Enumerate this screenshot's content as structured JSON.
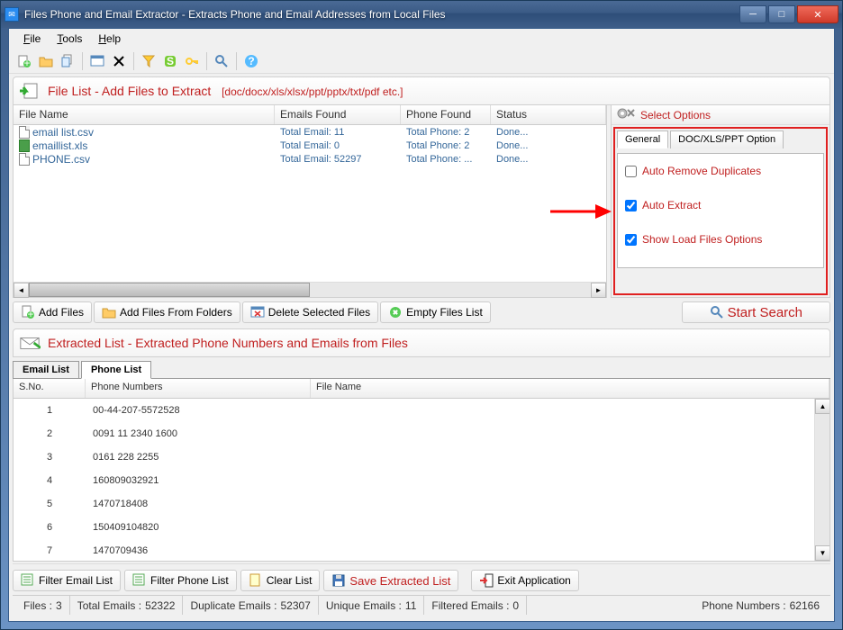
{
  "window": {
    "title": "Files Phone and Email Extractor -  Extracts Phone and Email Addresses from Local Files"
  },
  "menu": {
    "file": "File",
    "tools": "Tools",
    "help": "Help"
  },
  "panelTop": {
    "title": "File List - Add Files to Extract",
    "sub": "[doc/docx/xls/xlsx/ppt/pptx/txt/pdf etc.]"
  },
  "fileGrid": {
    "cols": {
      "name": "File Name",
      "emails": "Emails Found",
      "phone": "Phone Found",
      "status": "Status"
    },
    "rows": [
      {
        "name": "email list.csv",
        "emails": "Total Email: 11",
        "phone": "Total Phone: 2",
        "status": "Done..."
      },
      {
        "name": "emaillist.xls",
        "emails": "Total Email: 0",
        "phone": "Total Phone: 2",
        "status": "Done..."
      },
      {
        "name": "PHONE.csv",
        "emails": "Total Email: 52297",
        "phone": "Total Phone: ...",
        "status": "Done..."
      }
    ]
  },
  "options": {
    "title": "Select Options",
    "tabGeneral": "General",
    "tabDoc": "DOC/XLS/PPT Option",
    "removeDup": {
      "label": "Auto Remove Duplicates",
      "checked": false
    },
    "autoExtract": {
      "label": "Auto Extract",
      "checked": true
    },
    "showLoad": {
      "label": "Show Load Files Options",
      "checked": true
    }
  },
  "fileButtons": {
    "addFiles": "Add Files",
    "addFolders": "Add Files From Folders",
    "deleteSelected": "Delete Selected Files",
    "emptyList": "Empty Files List",
    "startSearch": "Start Search"
  },
  "panelBottom": {
    "title": "Extracted List - Extracted Phone Numbers and Emails from Files"
  },
  "resultTabs": {
    "email": "Email List",
    "phone": "Phone List"
  },
  "resultGrid": {
    "cols": {
      "sno": "S.No.",
      "phone": "Phone Numbers",
      "file": "File Name"
    },
    "rows": [
      {
        "sno": "1",
        "phone": "00-44-207-5572528"
      },
      {
        "sno": "2",
        "phone": "0091 11 2340 1600"
      },
      {
        "sno": "3",
        "phone": "0161 228 2255"
      },
      {
        "sno": "4",
        "phone": "160809032921"
      },
      {
        "sno": "5",
        "phone": "1470718408"
      },
      {
        "sno": "6",
        "phone": "150409104820"
      },
      {
        "sno": "7",
        "phone": "1470709436"
      }
    ]
  },
  "lowerButtons": {
    "filterEmail": "Filter Email List",
    "filterPhone": "Filter Phone List",
    "clear": "Clear List",
    "save": "Save Extracted List",
    "exit": "Exit Application"
  },
  "status": {
    "filesLabel": "Files :",
    "files": "3",
    "totalLabel": "Total Emails :",
    "total": "52322",
    "dupLabel": "Duplicate Emails :",
    "dup": "52307",
    "uniqLabel": "Unique Emails :",
    "uniq": "11",
    "filtLabel": "Filtered Emails :",
    "filt": "0",
    "phoneLabel": "Phone Numbers :",
    "phone": "62166"
  }
}
